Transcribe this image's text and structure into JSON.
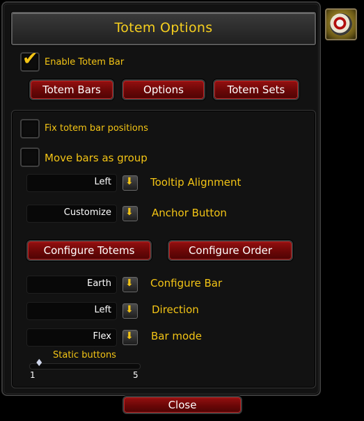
{
  "title": "Totem Options",
  "enable_label": "Enable Totem Bar",
  "tabs": {
    "totem_bars": "Totem Bars",
    "options": "Options",
    "totem_sets": "Totem Sets"
  },
  "fix_positions_label": "Fix totem bar positions",
  "move_group_label": "Move bars as group",
  "tooltip_alignment": {
    "value": "Left",
    "label": "Tooltip Alignment"
  },
  "anchor_button": {
    "value": "Customize",
    "label": "Anchor Button"
  },
  "configure_totems": "Configure Totems",
  "configure_order": "Configure Order",
  "configure_bar": {
    "value": "Earth",
    "label": "Configure Bar"
  },
  "direction": {
    "value": "Left",
    "label": "Direction"
  },
  "bar_mode": {
    "value": "Flex",
    "label": "Bar mode"
  },
  "static_buttons": {
    "label": "Static buttons",
    "min": "1",
    "max": "5",
    "value": 1
  },
  "close": "Close",
  "checkbox_states": {
    "enable": true,
    "fix_positions": false,
    "move_group": false
  },
  "accent_color": "#f3c415"
}
